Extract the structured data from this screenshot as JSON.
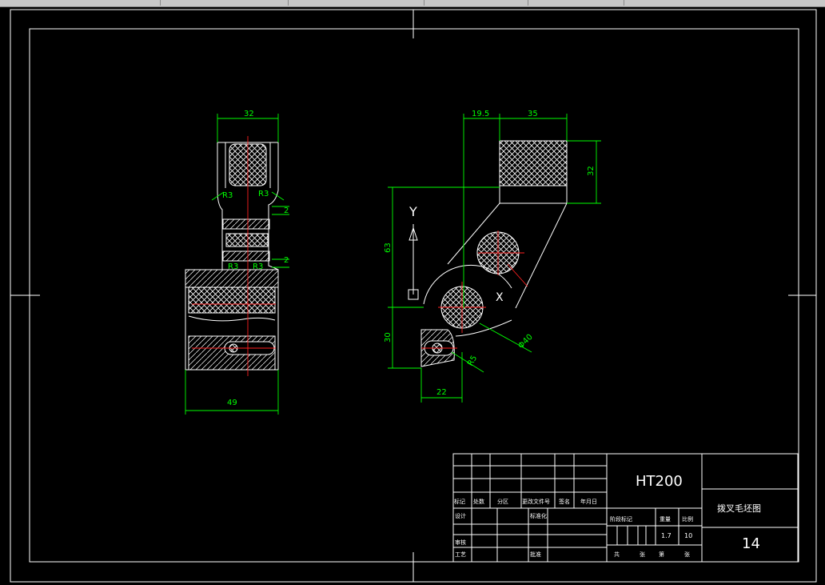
{
  "drawing": {
    "dims": {
      "d32_top": "32",
      "r3_a": "R3",
      "r3_b": "R3",
      "d2_a": "2",
      "r3_c": "R3",
      "r3_d": "R3",
      "d2_b": "2",
      "d49": "49",
      "d19_5": "19.5",
      "d35": "35",
      "d32_side": "32",
      "d63": "63",
      "d30": "30",
      "d22": "22",
      "phi40": "Φ40",
      "r5": "R5"
    },
    "axis": {
      "y_label": "Y",
      "x_label": "X"
    }
  },
  "title_block": {
    "material": "HT200",
    "drawing_name": "拨叉毛坯图",
    "number": "14",
    "headers": [
      "标记",
      "处数",
      "分区",
      "更改文件号",
      "签名",
      "年月日"
    ],
    "left_rows": [
      "设计",
      "审核",
      "工艺"
    ],
    "left_extra": [
      "标准化",
      "批准"
    ],
    "stage_labels": [
      "阶段标记",
      "重量",
      "比例"
    ],
    "weight": "1.7",
    "scale": "10",
    "sheet_labels": [
      "共",
      "张",
      "第",
      "张"
    ]
  },
  "colors": {
    "outline": "#ffffff",
    "dimension": "#00ff00",
    "centerline": "#ff2020",
    "background": "#000000"
  }
}
